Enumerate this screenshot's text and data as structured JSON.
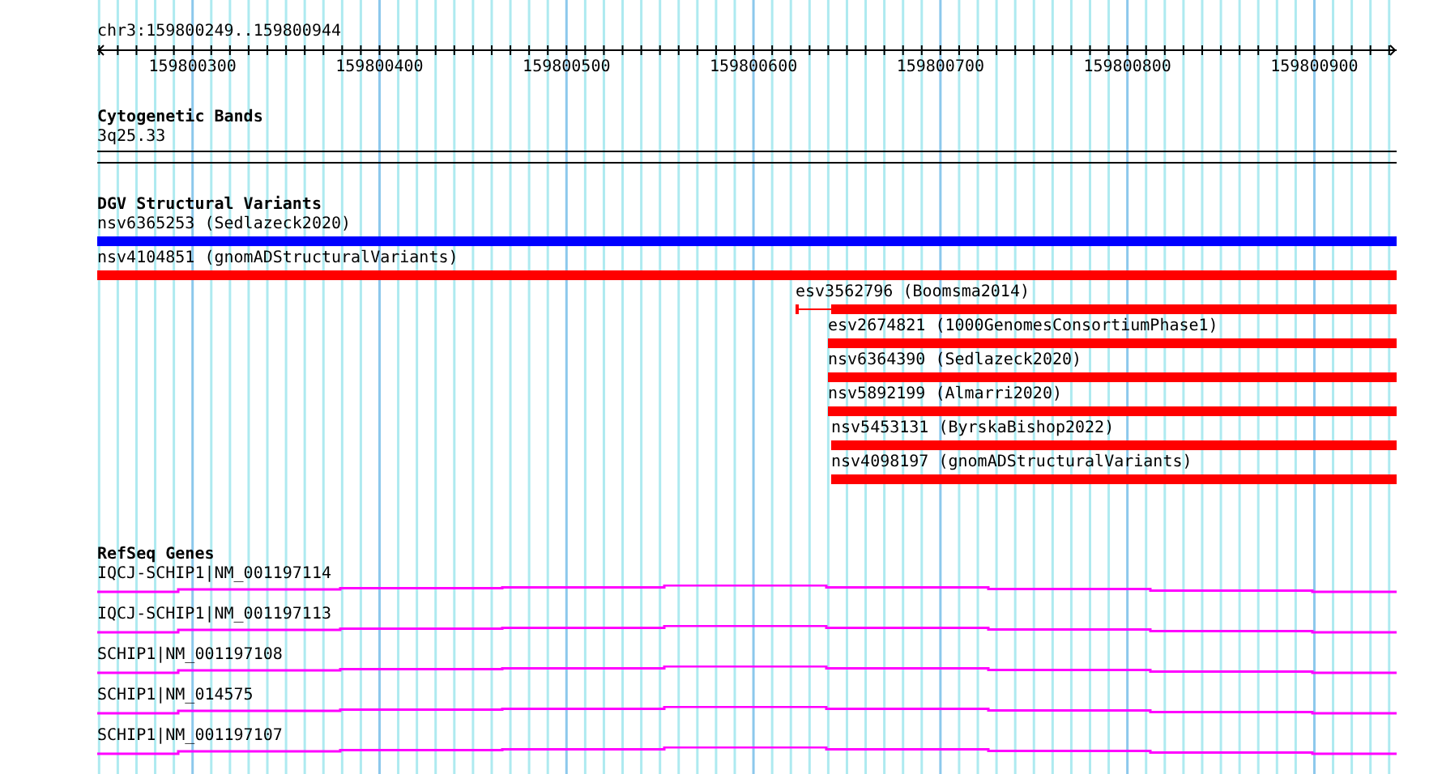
{
  "locus": "chr3:159800249..159800944",
  "ruler": {
    "ticks": [
      "159800300",
      "159800400",
      "159800500",
      "159800600",
      "159800700",
      "159800800",
      "159800900"
    ]
  },
  "cytogenetic_bands": {
    "title": "Cytogenetic Bands",
    "band": "3q25.33"
  },
  "structural_variants": {
    "title": "DGV Structural Variants",
    "items": [
      {
        "label": "nsv6365253 (Sedlazeck2020)",
        "color": "#0000ff"
      },
      {
        "label": "nsv4104851 (gnomADStructuralVariants)",
        "color": "#ff0000"
      },
      {
        "label": "esv3562796 (Boomsma2014)",
        "color": "#ff0000"
      },
      {
        "label": "esv2674821 (1000GenomesConsortiumPhase1)",
        "color": "#ff0000"
      },
      {
        "label": "nsv6364390 (Sedlazeck2020)",
        "color": "#ff0000"
      },
      {
        "label": "nsv5892199 (Almarri2020)",
        "color": "#ff0000"
      },
      {
        "label": "nsv5453131 (ByrskaBishop2022)",
        "color": "#ff0000"
      },
      {
        "label": "nsv4098197 (gnomADStructuralVariants)",
        "color": "#ff0000"
      }
    ]
  },
  "refseq_genes": {
    "title": "RefSeq Genes",
    "items": [
      {
        "label": "IQCJ-SCHIP1|NM_001197114"
      },
      {
        "label": "IQCJ-SCHIP1|NM_001197113"
      },
      {
        "label": "SCHIP1|NM_001197108"
      },
      {
        "label": "SCHIP1|NM_014575"
      },
      {
        "label": "SCHIP1|NM_001197107"
      }
    ]
  }
}
